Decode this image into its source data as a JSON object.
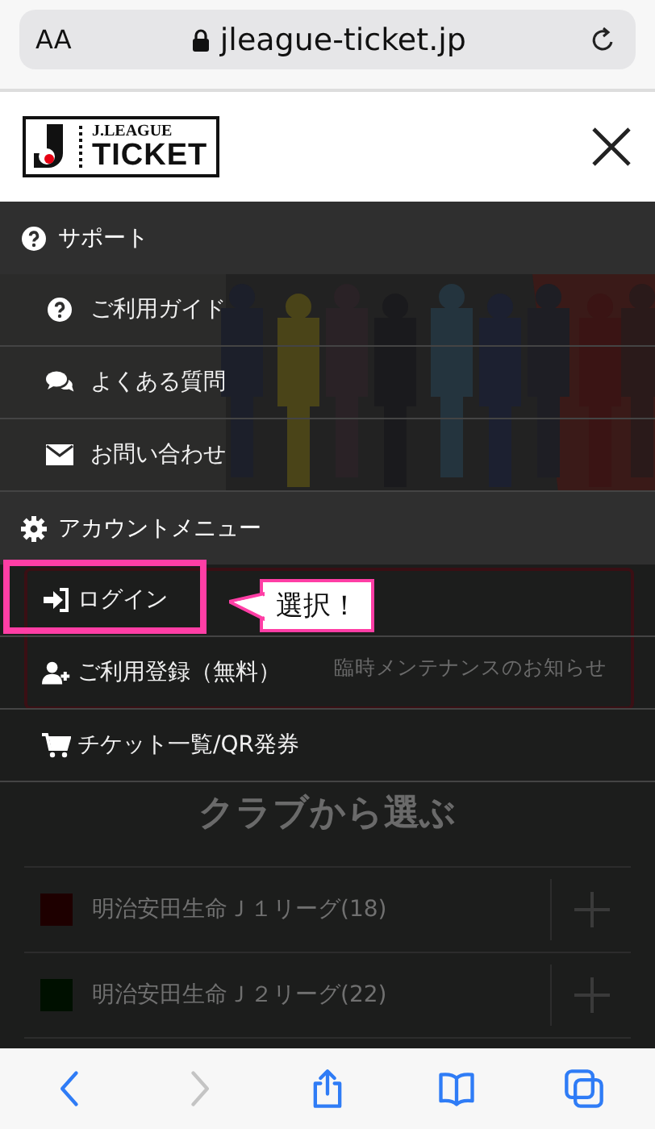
{
  "browser": {
    "text_size_button": "AA",
    "url": "jleague-ticket.jp"
  },
  "header": {
    "logo": {
      "line_1": "J.LEAGUE",
      "line_2": "TICKET"
    }
  },
  "menu": {
    "sections": [
      {
        "title": "サポート",
        "items": [
          {
            "label": "ご利用ガイド",
            "highlighted": false
          },
          {
            "label": "よくある質問",
            "highlighted": false
          },
          {
            "label": "お問い合わせ",
            "highlighted": false
          }
        ]
      },
      {
        "title": "アカウントメニュー",
        "items": [
          {
            "label": "ログイン",
            "highlighted": true
          },
          {
            "label": "ご利用登録（無料）",
            "highlighted": false
          },
          {
            "label": "チケット一覧/QR発券",
            "highlighted": false
          }
        ]
      }
    ]
  },
  "callout": {
    "text": "選択！"
  },
  "background": {
    "notice": "臨時メンテナンスのお知らせ",
    "heading": "クラブから選ぶ",
    "leagues": [
      {
        "name": "明治安田生命Ｊ１リーグ(18)",
        "color": "#1e0000"
      },
      {
        "name": "明治安田生命Ｊ２リーグ(22)",
        "color": "#001000"
      }
    ]
  },
  "toolbar": {
    "buttons": [
      {
        "kind": "back",
        "disabled": false
      },
      {
        "kind": "forward",
        "disabled": true
      },
      {
        "kind": "share",
        "disabled": false
      },
      {
        "kind": "bookmarks",
        "disabled": false
      },
      {
        "kind": "tabs",
        "disabled": false
      }
    ]
  }
}
